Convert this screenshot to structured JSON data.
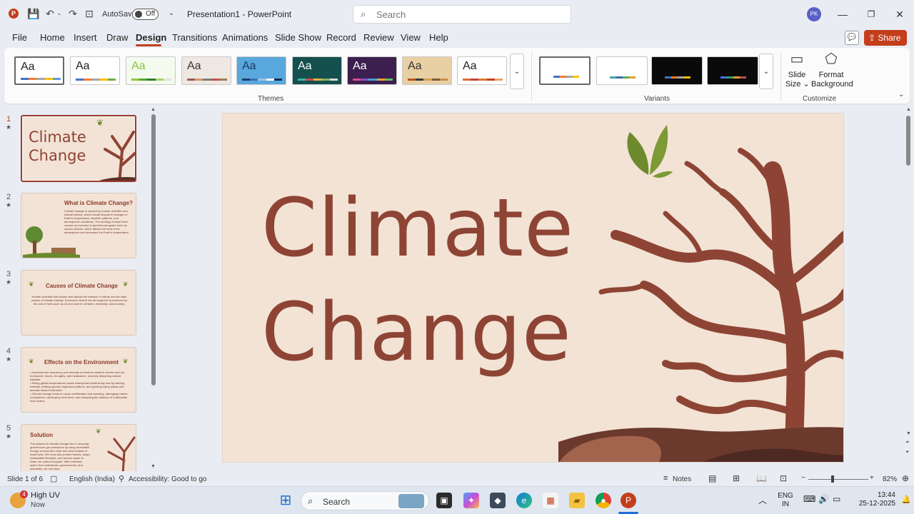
{
  "titlebar": {
    "autosave_label": "AutoSave",
    "autosave_state": "Off",
    "document_title": "Presentation1  -  PowerPoint",
    "search_placeholder": "Search",
    "user_initials": "PK"
  },
  "ribbon_tabs": [
    "File",
    "Home",
    "Insert",
    "Draw",
    "Design",
    "Transitions",
    "Animations",
    "Slide Show",
    "Record",
    "Review",
    "View",
    "Help"
  ],
  "active_tab": "Design",
  "share_label": "Share",
  "ribbon": {
    "themes_label": "Themes",
    "variants_label": "Variants",
    "customize_label": "Customize",
    "theme_glyph": "Aa",
    "slide_size_label": "Slide\nSize",
    "format_background_label": "Format\nBackground",
    "themes": [
      {
        "bg": "#ffffff",
        "fg": "#222222",
        "bars": [
          "#4472c4",
          "#ed7d31",
          "#a5a5a5",
          "#ffc000",
          "#5b9bd5"
        ]
      },
      {
        "bg": "#ffffff",
        "fg": "#222222",
        "bars": [
          "#4472c4",
          "#ed7d31",
          "#a5a5a5",
          "#ffc000",
          "#70ad47"
        ]
      },
      {
        "bg": "#f4faee",
        "fg": "#8cc43e",
        "bars": [
          "#8cc43e",
          "#4ea72e",
          "#2e7d32",
          "#a3d36b",
          "#e0e0e0"
        ]
      },
      {
        "bg": "#efe7e2",
        "fg": "#333333",
        "bars": [
          "#a05a5a",
          "#d19a66",
          "#7d7d7d",
          "#c0504d",
          "#9c7a5b"
        ]
      },
      {
        "bg": "#5aa7de",
        "fg": "#1a3c66",
        "bars": [
          "#1a3c66",
          "#2f75b5",
          "#9dc3e6",
          "#ffffff",
          "#0b2e4f"
        ]
      },
      {
        "bg": "#14504d",
        "fg": "#ffffff",
        "bars": [
          "#3bb6ad",
          "#c84b4b",
          "#e8b23c",
          "#7fb36a",
          "#d9d9d9"
        ]
      },
      {
        "bg": "#3c1f4e",
        "fg": "#ffffff",
        "bars": [
          "#e24b8a",
          "#7b55c4",
          "#3fa5d6",
          "#f2a33a",
          "#67b968"
        ]
      },
      {
        "bg": "#e8cfa4",
        "fg": "#333333",
        "bars": [
          "#b5561e",
          "#3a3a3a",
          "#d4a055",
          "#7a5c3e",
          "#c98b49"
        ]
      },
      {
        "bg": "#ffffff",
        "fg": "#222222",
        "bars": [
          "#e06a2c",
          "#b44",
          "#d9772c",
          "#c04020",
          "#f0a060"
        ]
      }
    ],
    "variants": [
      {
        "bg": "#ffffff",
        "bars": [
          "#4472c4",
          "#ed7d31",
          "#a5a5a5",
          "#ffc000"
        ]
      },
      {
        "bg": "#ffffff",
        "bars": [
          "#44a3a3",
          "#3b6bb0",
          "#6aaa4e",
          "#e0a030"
        ]
      },
      {
        "bg": "#0a0a0a",
        "bars": [
          "#4472c4",
          "#ed7d31",
          "#a5a5a5",
          "#ffc000"
        ]
      },
      {
        "bg": "#0a0a0a",
        "bars": [
          "#3c78d8",
          "#38a169",
          "#e0a030",
          "#c0504d"
        ]
      }
    ]
  },
  "slides": [
    {
      "number": "1",
      "title": "Climate\nChange"
    },
    {
      "number": "2",
      "title": "What is Climate Change?",
      "body": "Climate change is caused by human activities and natural factors, which create long-term changes in Earth's temperature, weather patterns, and atmospheric conditions. The burning of fossil fuels causes an increase in greenhouse gases such as carbon dioxide, which affects the heat in the atmosphere and increases the Earth's temperature."
    },
    {
      "number": "3",
      "title": "Causes of Climate Change",
      "body": "Human activities that pollute and disrupt the balance of nature are the main causes of climate change. Excessive heat in the atmosphere is produced by the use of fuels such as oil and coal for vehicles, electricity, and industry."
    },
    {
      "number": "4",
      "title": "Effects on the Environment",
      "body": "• Increases the frequency and intensity of extreme weather events such as hurricanes, floods, droughts, and heatwaves, severely disrupting natural habitats.\n• Rising global temperatures cause widespread biodiversity loss by altering habitats, shifting species migration patterns, and pushing many plants and animals toward extinction.\n• Climate change leads to ocean acidification and warming, damaging marine ecosystems, destroying coral reefs, and disrupting the balance of underwater food chains."
    },
    {
      "number": "5",
      "title": "Solution",
      "body": "The solution to climate change lies in reducing greenhouse gas emissions by using renewable energy sources like solar and wind instead of fossil fuels. We must also protect forests, adopt sustainable lifestyles, and reduce waste to lower our carbon footprint. With collective action from individuals, governments, and industries, we can slow"
    }
  ],
  "main_slide": {
    "title_line1": "Climate",
    "title_line2": "Change",
    "background": "#f2e3d5",
    "title_color": "#8e4434"
  },
  "statusbar": {
    "slide_info": "Slide 1 of 6",
    "language": "English (India)",
    "accessibility": "Accessibility: Good to go",
    "notes_label": "Notes",
    "zoom": "82%",
    "zoom_fraction": 0.4
  },
  "taskbar": {
    "weather_title": "High UV",
    "weather_sub": "Now",
    "weather_badge": "4",
    "search_label": "Search",
    "lang_top": "ENG",
    "lang_bottom": "IN",
    "time": "13:44",
    "date": "25-12-2025"
  },
  "colors": {
    "accent": "#c43e1c",
    "slide_brown": "#8e4434",
    "leaf_green": "#6b8a2d"
  }
}
